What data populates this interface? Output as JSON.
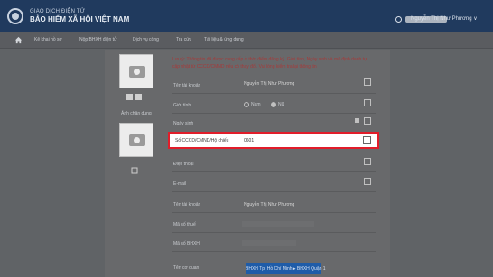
{
  "header": {
    "brand_top": "GIAO DỊCH ĐIỆN TỬ",
    "brand_main": "BẢO HIỂM XÃ HỘI VIỆT NAM",
    "user_name": "Nguyễn Thị Như Phương ∨"
  },
  "nav": {
    "items": [
      "Kê khai hồ sơ",
      "Nộp BHXH điện tử",
      "Dịch vụ công",
      "Tra cứu",
      "Tài liệu & ứng dụng"
    ]
  },
  "profile": {
    "photo_label": "Ảnh chân dung",
    "note_lines": [
      "Lưu ý: Thông tin đã được cung cấp ở thời điểm đăng ký. Giới tính, Ngày sinh và mã định danh tự",
      "cập nhật từ CCCD/CMND nếu có thay đổi. Vui lòng kiểm tra lại thông tin"
    ],
    "fields": [
      {
        "label": "Tên tài khoản",
        "value": "Nguyễn Thị Như Phương"
      },
      {
        "label": "Giới tính",
        "value": ""
      },
      {
        "label": "Ngày sinh",
        "value": ""
      },
      {
        "label": "Số CCCD/CMND/Hộ chiếu",
        "value": "0601"
      },
      {
        "label": "Điện thoại",
        "value": ""
      },
      {
        "label": "E-mail",
        "value": ""
      },
      {
        "label": "Tên tài khoản",
        "value": "Nguyễn Thị Như Phương"
      },
      {
        "label": "Mã số thuế",
        "value": ""
      },
      {
        "label": "Mã số BHXH",
        "value": ""
      },
      {
        "label": "Tên cơ quan",
        "value": ""
      }
    ],
    "gender_options": [
      "Nam",
      "Nữ"
    ],
    "agency_button": "BHXH Tp. Hồ Chí Minh ▸ BHXH Quận 1"
  },
  "colors": {
    "highlight": "#e11d2a",
    "header_bg": "#203a5e",
    "button": "#1f5ca8"
  }
}
